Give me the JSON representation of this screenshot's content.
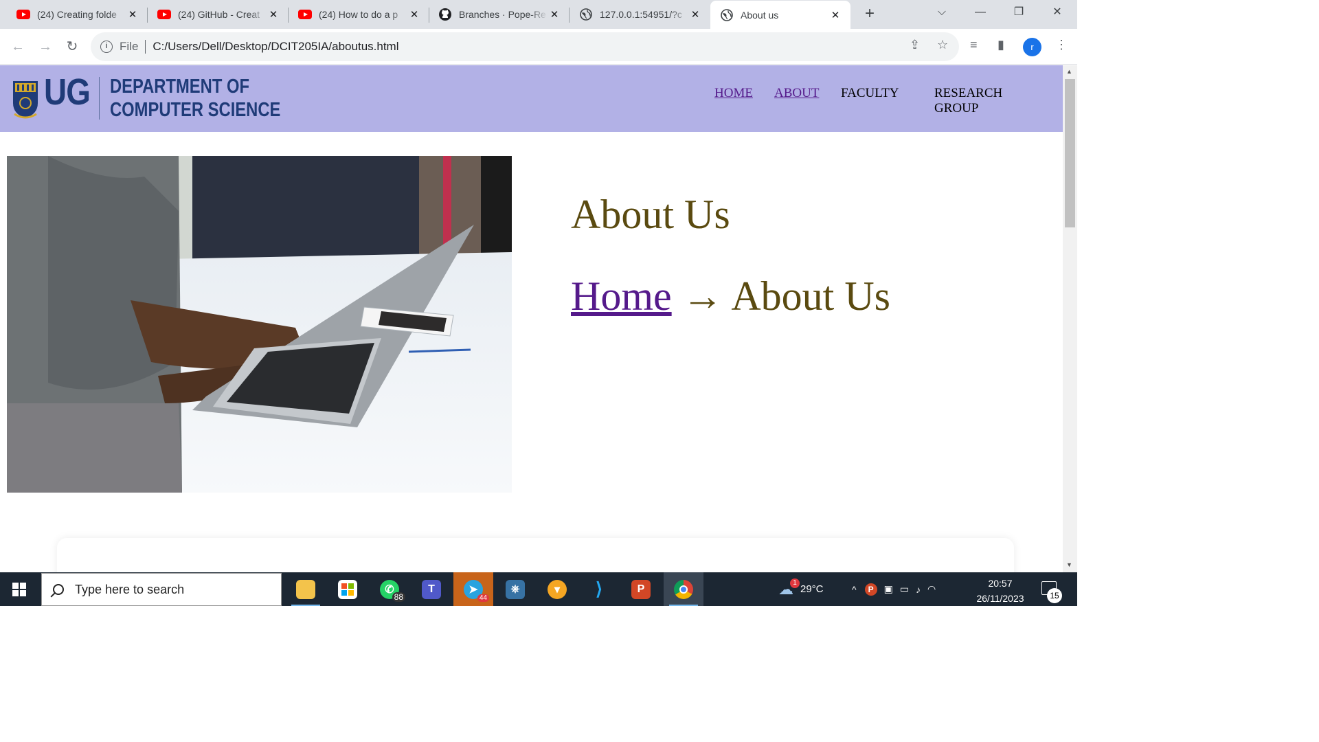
{
  "browser": {
    "tabs": [
      {
        "title": "(24) Creating folde",
        "icon": "youtube-icon"
      },
      {
        "title": "(24) GitHub - Creat",
        "icon": "youtube-icon"
      },
      {
        "title": "(24) How to do a p",
        "icon": "youtube-icon"
      },
      {
        "title": "Branches · Pope-Re",
        "icon": "github-icon"
      },
      {
        "title": "127.0.0.1:54951/?c",
        "icon": "globe-icon"
      },
      {
        "title": "About us",
        "icon": "globe-icon",
        "active": true
      }
    ],
    "new_tab": "+",
    "address": {
      "scheme": "File",
      "url": "C:/Users/Dell/Desktop/DCIT205IA/aboutus.html"
    },
    "profile_initial": "r"
  },
  "site": {
    "logo_text": "UG",
    "department_line1": "DEPARTMENT OF",
    "department_line2": "COMPUTER SCIENCE",
    "nav": {
      "home": "HOME",
      "about": "ABOUT",
      "faculty": "FACULTY",
      "research_line1": "RESEARCH",
      "research_line2": "GROUP"
    },
    "header_color": "#b2b1e6"
  },
  "main": {
    "title": "About Us",
    "breadcrumb": {
      "home": "Home",
      "arrow": "→",
      "current": "About Us"
    }
  },
  "taskbar": {
    "search_placeholder": "Type here to search",
    "whatsapp_badge": "88",
    "telegram_badge": "44",
    "weather": "29°C",
    "weather_alert": "1",
    "time": "20:57",
    "date": "26/11/2023",
    "notifications": "15"
  }
}
